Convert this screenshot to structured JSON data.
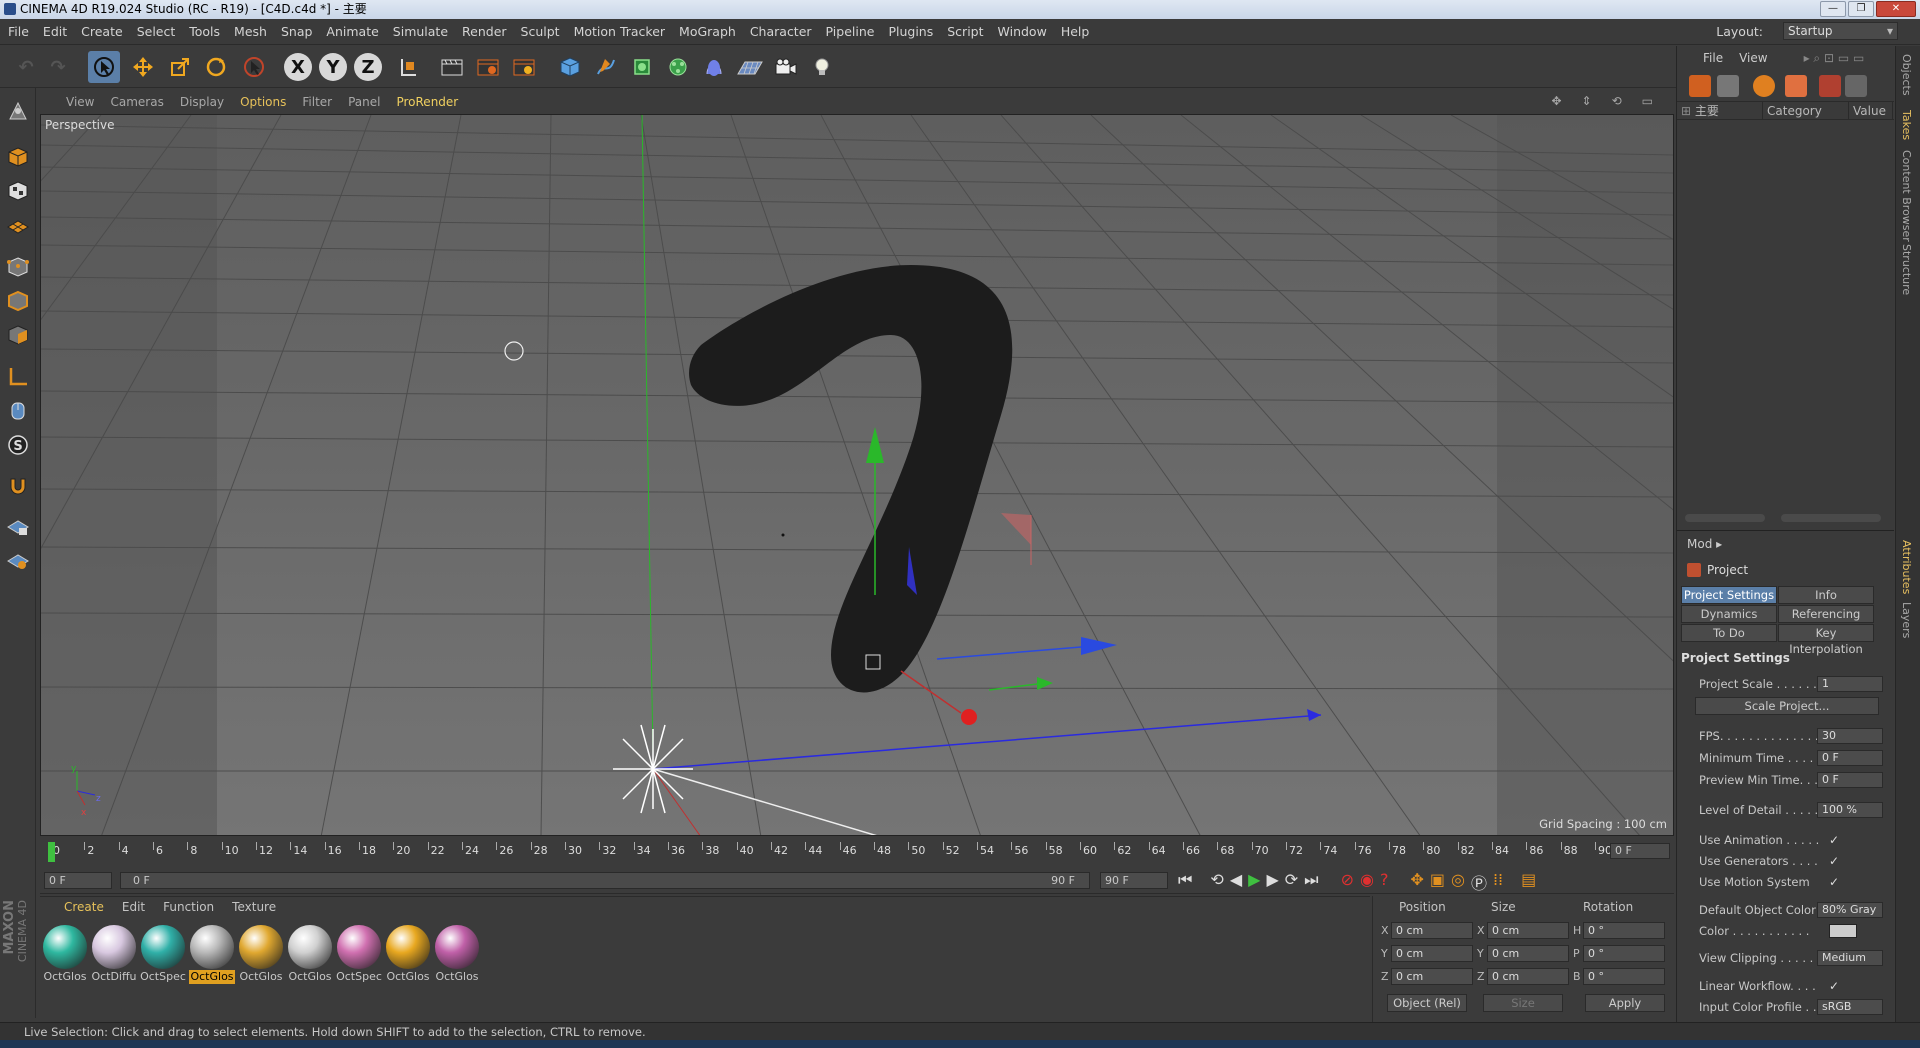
{
  "window": {
    "title": "CINEMA 4D R19.024 Studio (RC - R19) - [C4D.c4d *] - 主要"
  },
  "menubar": {
    "items": [
      "File",
      "Edit",
      "Create",
      "Select",
      "Tools",
      "Mesh",
      "Snap",
      "Animate",
      "Simulate",
      "Render",
      "Sculpt",
      "Motion Tracker",
      "MoGraph",
      "Character",
      "Pipeline",
      "Plugins",
      "Script",
      "Window",
      "Help"
    ],
    "layout_label": "Layout:",
    "layout_value": "Startup"
  },
  "toolbar": {
    "axis_x": "X",
    "axis_y": "Y",
    "axis_z": "Z"
  },
  "viewport": {
    "menu": [
      "View",
      "Cameras",
      "Display",
      "Options",
      "Filter",
      "Panel",
      "ProRender"
    ],
    "label": "Perspective",
    "grid_spacing": "Grid Spacing : 100 cm"
  },
  "objects": {
    "menu": [
      "File",
      "View"
    ],
    "tree_root": "主要",
    "col_category": "Category",
    "col_value": "Value"
  },
  "right_tabs": [
    "Objects",
    "Takes",
    "Content Browser",
    "Structure",
    "Attributes",
    "Layers"
  ],
  "attributes": {
    "mode_label": "Mod",
    "object_name": "Project",
    "tabs": [
      "Project Settings",
      "Info",
      "Dynamics",
      "Referencing",
      "To Do",
      "Key Interpolation"
    ],
    "section_title": "Project Settings",
    "project_scale_label": "Project Scale . . . . . .",
    "project_scale_value": "1",
    "scale_project_button": "Scale Project...",
    "fps_label": "FPS. . . . . . . . . . . . . . .",
    "fps_value": "30",
    "min_time_label": "Minimum Time . . . .",
    "min_time_value": "0 F",
    "preview_min_label": "Preview Min Time. . .",
    "preview_min_value": "0 F",
    "lod_label": "Level of Detail . . . . .",
    "lod_value": "100 %",
    "use_animation_label": "Use Animation . . . . .",
    "use_generators_label": "Use Generators . . . .",
    "use_motion_label": "Use Motion System",
    "default_color_label": "Default Object Color",
    "default_color_value": "80% Gray",
    "color_label": "Color . . . . . . . . . . .",
    "view_clipping_label": "View Clipping . . . . .",
    "view_clipping_value": "Medium",
    "linear_workflow_label": "Linear Workflow. . . .",
    "input_profile_label": "Input Color Profile . .",
    "input_profile_value": "sRGB",
    "check": "✓"
  },
  "timeline": {
    "ticks": [
      "0",
      "2",
      "4",
      "6",
      "8",
      "10",
      "12",
      "14",
      "16",
      "18",
      "20",
      "22",
      "24",
      "26",
      "28",
      "30",
      "32",
      "34",
      "36",
      "38",
      "40",
      "42",
      "44",
      "46",
      "48",
      "50",
      "52",
      "54",
      "56",
      "58",
      "60",
      "62",
      "64",
      "66",
      "68",
      "70",
      "72",
      "74",
      "76",
      "78",
      "80",
      "82",
      "84",
      "86",
      "88",
      "90"
    ],
    "current_frame": "0 F"
  },
  "transport": {
    "start_field": "0 F",
    "range_start": "0 F",
    "range_end": "90 F",
    "end_field": "90 F"
  },
  "materials": {
    "menu": [
      "Create",
      "Edit",
      "Function",
      "Texture"
    ],
    "items": [
      {
        "label": "OctGlos",
        "color": "#2fb8a0"
      },
      {
        "label": "OctDiffu",
        "color": "#d8c8e0"
      },
      {
        "label": "OctSpec",
        "color": "#30b0a8"
      },
      {
        "label": "OctGlos",
        "color": "#b8b8b8"
      },
      {
        "label": "OctGlos",
        "color": "#e0a830"
      },
      {
        "label": "OctGlos",
        "color": "#d0d0d0"
      },
      {
        "label": "OctSpec",
        "color": "#d070b0"
      },
      {
        "label": "OctGlos",
        "color": "#e8a820"
      },
      {
        "label": "OctGlos",
        "color": "#c060a8"
      }
    ]
  },
  "coordinates": {
    "position_header": "Position",
    "size_header": "Size",
    "rotation_header": "Rotation",
    "pos_x": "0 cm",
    "pos_y": "0 cm",
    "pos_z": "0 cm",
    "size_x": "0 cm",
    "size_y": "0 cm",
    "size_z": "0 cm",
    "rot_h": "0 °",
    "rot_p": "0 °",
    "rot_b": "0 °",
    "label_x": "X",
    "label_y": "Y",
    "label_z": "Z",
    "label_h": "H",
    "label_p": "P",
    "label_b": "B",
    "mode_select": "Object (Rel)",
    "size_select": "Size",
    "apply_button": "Apply"
  },
  "status": {
    "text": "Live Selection: Click and drag to select elements. Hold down SHIFT to add to the selection, CTRL to remove."
  },
  "brand": {
    "maxon": "MAXON",
    "cinema": "CINEMA 4D"
  }
}
